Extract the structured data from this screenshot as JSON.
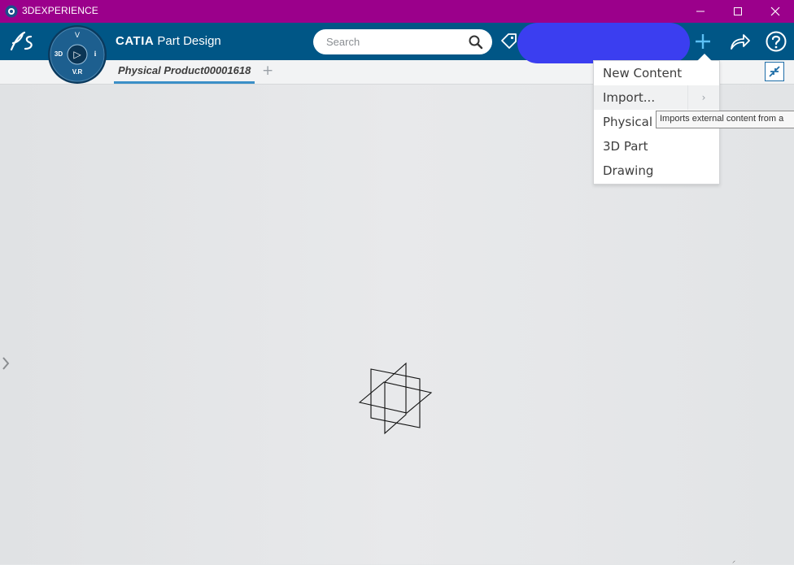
{
  "window": {
    "title": "3DEXPERIENCE"
  },
  "header": {
    "compass": {
      "top": "V",
      "left": "3D",
      "center": "▷",
      "right": "i",
      "bottom": "V.R"
    },
    "app_brand": "CATIA",
    "app_name": "Part Design",
    "search": {
      "placeholder": "Search"
    }
  },
  "tabs": {
    "active_label": "Physical Product00001618",
    "add_label": "+"
  },
  "menu": {
    "items": [
      {
        "label": "New Content"
      },
      {
        "label": "Import..."
      },
      {
        "label": "Physical P"
      },
      {
        "label": "3D Part"
      },
      {
        "label": "Drawing"
      }
    ]
  },
  "tooltip": {
    "text": "Imports external content from a"
  },
  "colors": {
    "titlebar": "#9b008b",
    "header": "#005686",
    "accent": "#3a8fc7",
    "canvas": "#e4e6e8",
    "redaction": "#3b3ef0"
  }
}
